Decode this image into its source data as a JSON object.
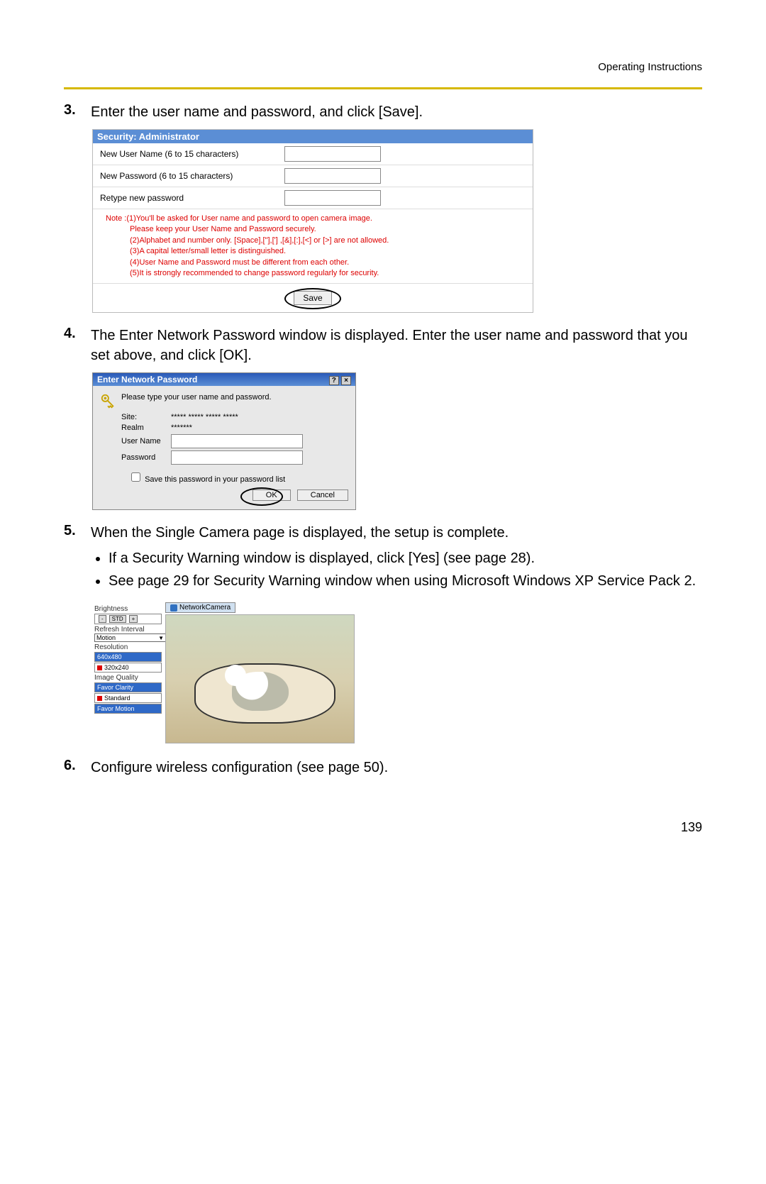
{
  "header": {
    "title": "Operating Instructions"
  },
  "steps": {
    "s3": {
      "num": "3.",
      "text": "Enter the user name and password, and click [Save]."
    },
    "s4": {
      "num": "4.",
      "text": "The Enter Network Password window is displayed. Enter the user name and password that you set above, and click [OK]."
    },
    "s5": {
      "num": "5.",
      "text": "When the Single Camera page is displayed, the setup is complete.",
      "bullets": {
        "b1": "If a Security Warning window is displayed, click [Yes] (see page 28).",
        "b2": "See page 29 for Security Warning window when using Microsoft Windows XP Service Pack 2."
      }
    },
    "s6": {
      "num": "6.",
      "text": "Configure wireless configuration (see page 50)."
    }
  },
  "security_box": {
    "title": "Security: Administrator",
    "row1": "New User Name (6 to 15 characters)",
    "row2": "New Password (6 to 15 characters)",
    "row3": "Retype new password",
    "note_prefix": "Note :",
    "note1": "(1)You'll be asked for User name and password to open camera image.",
    "note1b": "Please keep your User Name and Password securely.",
    "note2": "(2)Alphabet and number only. [Space],[\"],['] ,[&],[:],[<] or [>] are not allowed.",
    "note3": "(3)A capital letter/small letter is distinguished.",
    "note4": "(4)User Name and Password must be different from each other.",
    "note5": "(5)It is strongly recommended to change password regularly for security.",
    "save_label": "Save"
  },
  "enp_box": {
    "title": "Enter Network Password",
    "help": "?",
    "close": "×",
    "prompt": "Please type your user name and password.",
    "site_label": "Site:",
    "site_value": "***** ***** *****  *****",
    "realm_label": "Realm",
    "realm_value": "*******",
    "user_label": "User Name",
    "pass_label": "Password",
    "check_label": "Save this password in your password list",
    "ok": "OK",
    "cancel": "Cancel"
  },
  "camera_box": {
    "tab": "NetworkCamera",
    "brightness_label": "Brightness",
    "brightness_minus": "-",
    "brightness_std": "STD",
    "brightness_plus": "+",
    "refresh_label": "Refresh Interval",
    "refresh_value": "Motion",
    "resolution_label": "Resolution",
    "res1": "640x480",
    "res2": "320x240",
    "quality_label": "Image Quality",
    "q1": "Favor Clarity",
    "q2": "Standard",
    "q3": "Favor Motion"
  },
  "page_number": "139"
}
